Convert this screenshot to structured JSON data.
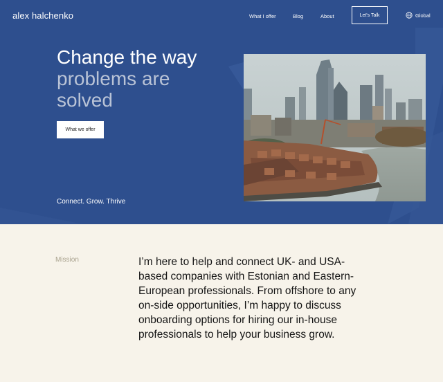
{
  "brand": "alex halchenko",
  "nav": {
    "what_i_offer": "What I offer",
    "blog": "Blog",
    "about": "About",
    "lets_talk": "Let's Talk",
    "global": "Global"
  },
  "hero": {
    "headline_line1": "Change the way",
    "headline_line2": "problems are",
    "headline_line3": "solved",
    "button_label": "What we offer",
    "tagline": "Connect. Grow. Thrive"
  },
  "mission": {
    "label": "Mission",
    "text": "I’m here to help and connect UK- and USA-based companies with Estonian and Eastern-European professionals. From offshore to any on-side opportunities, I’m happy to discuss onboarding options for hiring our in-house professionals to help your business grow."
  },
  "colors": {
    "hero_bg": "#2e4f8e",
    "page_bg": "#f7f3ea",
    "headline_muted": "#b9c3d6",
    "mission_label": "#a9a28e"
  },
  "icons": {
    "global": "globe-icon"
  }
}
